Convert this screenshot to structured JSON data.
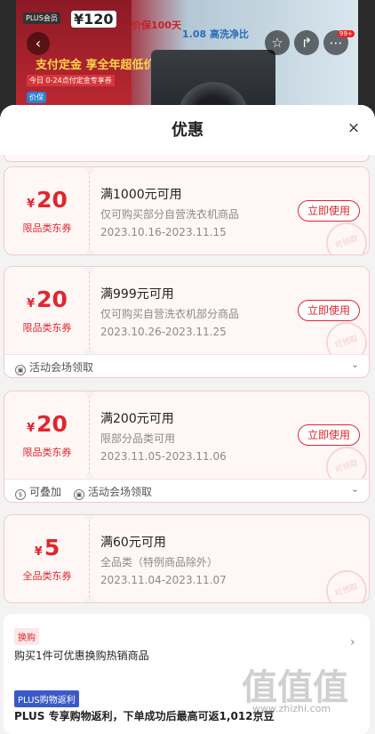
{
  "banner": {
    "plus_tag": "PLUS会员",
    "price": "¥120",
    "promo": "支付定金 享全年超低价",
    "promo_sub": "今日 0-24点付定金专享券",
    "promo_sub2": "价保",
    "mid_text": "价保100天",
    "mid_text2": "1.08 高洗净比",
    "back_icon": "back-icon",
    "badge": "99+"
  },
  "sheet": {
    "title": "优惠",
    "close": "×"
  },
  "coupons": [
    {
      "currency": "¥",
      "amount": "20",
      "label": "限品类东券",
      "condition": "满1000元可用",
      "description": "仅可购买部分自营洗衣机商品",
      "date": "2023.10.16-2023.11.15",
      "button": "立即使用",
      "stamp": "可领取"
    },
    {
      "currency": "¥",
      "amount": "20",
      "label": "限品类东券",
      "condition": "满999元可用",
      "description": "仅可购买自营洗衣机部分商品",
      "date": "2023.10.26-2023.11.25",
      "button": "立即使用",
      "stamp": "可领取",
      "foot": [
        "活动会场领取"
      ]
    },
    {
      "currency": "¥",
      "amount": "20",
      "label": "限品类东券",
      "condition": "满200元可用",
      "description": "限部分品类可用",
      "date": "2023.11.05-2023.11.06",
      "button": "立即使用",
      "stamp": "可领取",
      "foot": [
        "可叠加",
        "活动会场领取"
      ]
    },
    {
      "currency": "¥",
      "amount": "5",
      "label": "全品类东券",
      "condition": "满60元可用",
      "description": "全品类（特例商品除外）",
      "date": "2023.11.04-2023.11.07",
      "stamp": "可领取"
    }
  ],
  "swap": {
    "tag": "换购",
    "text": "购买1件可优惠换购热销商品"
  },
  "plus": {
    "tag": "PLUS购物返利",
    "text": "PLUS 专享购物返利，下单成功后最高可返1,012京豆"
  },
  "watermark": {
    "glyph": "值值值",
    "url": "www.zhizhi.com"
  }
}
